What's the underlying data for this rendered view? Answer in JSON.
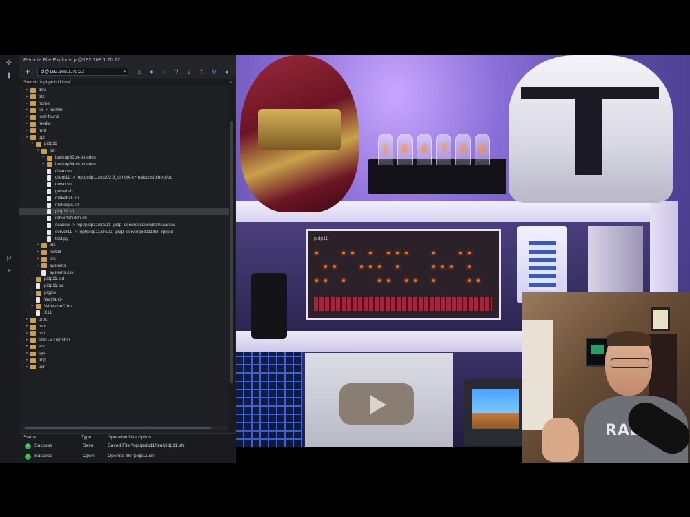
{
  "window": {
    "title": "Remote File Explorer:pi@192.168.1.70:22"
  },
  "toolbar": {
    "add_label": "+",
    "host_value": "pi@192.168.1.70:22",
    "icons": [
      "home-icon",
      "globe-icon",
      "disconnect-icon",
      "help-icon",
      "download-icon",
      "upload-icon",
      "refresh-icon",
      "broadcast-icon",
      "trash-icon"
    ]
  },
  "search": {
    "label": "Search '/opt/pidp11/bin/'"
  },
  "tree": [
    {
      "depth": 2,
      "kind": "folder",
      "label": "dev",
      "expanded": false
    },
    {
      "depth": 2,
      "kind": "folder",
      "label": "etc",
      "expanded": false
    },
    {
      "depth": 2,
      "kind": "folder",
      "label": "home",
      "expanded": false
    },
    {
      "depth": 2,
      "kind": "folder",
      "label": "lib -> /usr/lib",
      "expanded": false
    },
    {
      "depth": 2,
      "kind": "folder",
      "label": "lost+found",
      "expanded": false
    },
    {
      "depth": 2,
      "kind": "folder",
      "label": "media",
      "expanded": false
    },
    {
      "depth": 2,
      "kind": "folder",
      "label": "mnt",
      "expanded": false
    },
    {
      "depth": 2,
      "kind": "folder",
      "label": "opt",
      "expanded": true
    },
    {
      "depth": 3,
      "kind": "folder",
      "label": "pidp11",
      "expanded": true
    },
    {
      "depth": 4,
      "kind": "folder",
      "label": "bin",
      "expanded": true
    },
    {
      "depth": 5,
      "kind": "folder",
      "label": "backup32bit-binaries",
      "expanded": false
    },
    {
      "depth": 5,
      "kind": "folder",
      "label": "backup64bit-binaries",
      "expanded": false
    },
    {
      "depth": 5,
      "kind": "file",
      "label": "clean.sh"
    },
    {
      "depth": 5,
      "kind": "file",
      "label": "client11 -> /opt/pidp11/src/02.3_simh/4.x+realcons/bin-rpi/pd"
    },
    {
      "depth": 5,
      "kind": "file",
      "label": "down.sh"
    },
    {
      "depth": 5,
      "kind": "file",
      "label": "getsel.sh"
    },
    {
      "depth": 5,
      "kind": "file",
      "label": "makeball.sh"
    },
    {
      "depth": 5,
      "kind": "file",
      "label": "makeeps.sh"
    },
    {
      "depth": 5,
      "kind": "file",
      "label": "pidp11.sh",
      "selected": true
    },
    {
      "depth": 5,
      "kind": "file",
      "label": "rebootshutdn.sh"
    },
    {
      "depth": 5,
      "kind": "file",
      "label": "scansw -> /opt/pidp11/src/11_pidp_server/scanswitch/scansw"
    },
    {
      "depth": 5,
      "kind": "file",
      "label": "server11 -> /opt/pidp11/src/11_pidp_server/pidp11/bin-rpi/pid"
    },
    {
      "depth": 5,
      "kind": "file",
      "label": "test.py"
    },
    {
      "depth": 4,
      "kind": "folder",
      "label": "etc",
      "expanded": false
    },
    {
      "depth": 4,
      "kind": "folder",
      "label": "install",
      "expanded": false
    },
    {
      "depth": 4,
      "kind": "folder",
      "label": "src",
      "expanded": false
    },
    {
      "depth": 4,
      "kind": "folder",
      "label": "systems",
      "expanded": false
    },
    {
      "depth": 4,
      "kind": "file",
      "label": "systems.csv"
    },
    {
      "depth": 3,
      "kind": "folder",
      "label": "pidp11.old",
      "expanded": false
    },
    {
      "depth": 3,
      "kind": "file",
      "label": "pidp11.tar"
    },
    {
      "depth": 3,
      "kind": "folder",
      "label": "pigpio",
      "expanded": false
    },
    {
      "depth": 3,
      "kind": "file",
      "label": "Wayland-"
    },
    {
      "depth": 3,
      "kind": "folder",
      "label": "WidevineCdm",
      "expanded": false
    },
    {
      "depth": 3,
      "kind": "file",
      "label": "X11"
    },
    {
      "depth": 2,
      "kind": "folder",
      "label": "proc",
      "expanded": false
    },
    {
      "depth": 2,
      "kind": "folder",
      "label": "root",
      "expanded": false
    },
    {
      "depth": 2,
      "kind": "folder",
      "label": "run",
      "expanded": false
    },
    {
      "depth": 2,
      "kind": "folder",
      "label": "sbin -> /usr/sbin",
      "expanded": false
    },
    {
      "depth": 2,
      "kind": "folder",
      "label": "srv",
      "expanded": false
    },
    {
      "depth": 2,
      "kind": "folder",
      "label": "sys",
      "expanded": false
    },
    {
      "depth": 2,
      "kind": "folder",
      "label": "tmp",
      "expanded": false
    },
    {
      "depth": 2,
      "kind": "folder",
      "label": "usr",
      "expanded": false
    }
  ],
  "operations": {
    "headers": {
      "status": "Status",
      "type": "Type",
      "description": "Operation Description"
    },
    "rows": [
      {
        "status": "Success",
        "type": "Save",
        "description": "Saved File '/opt/pidp11/bin/pidp11.sh'"
      },
      {
        "status": "Success",
        "type": "Open",
        "description": "Opened file 'pidp11.sh'"
      }
    ]
  },
  "photo": {
    "nixie_digits": [
      "1",
      "6",
      "4",
      "7",
      "4",
      "6"
    ],
    "front_panel_brand": "pidp11",
    "shirt_text": "RADAR"
  },
  "colors": {
    "panel_bg": "#1e1f22",
    "folder": "#c9a04e",
    "success": "#33b24a",
    "accent_blue": "#4aa3ff"
  }
}
